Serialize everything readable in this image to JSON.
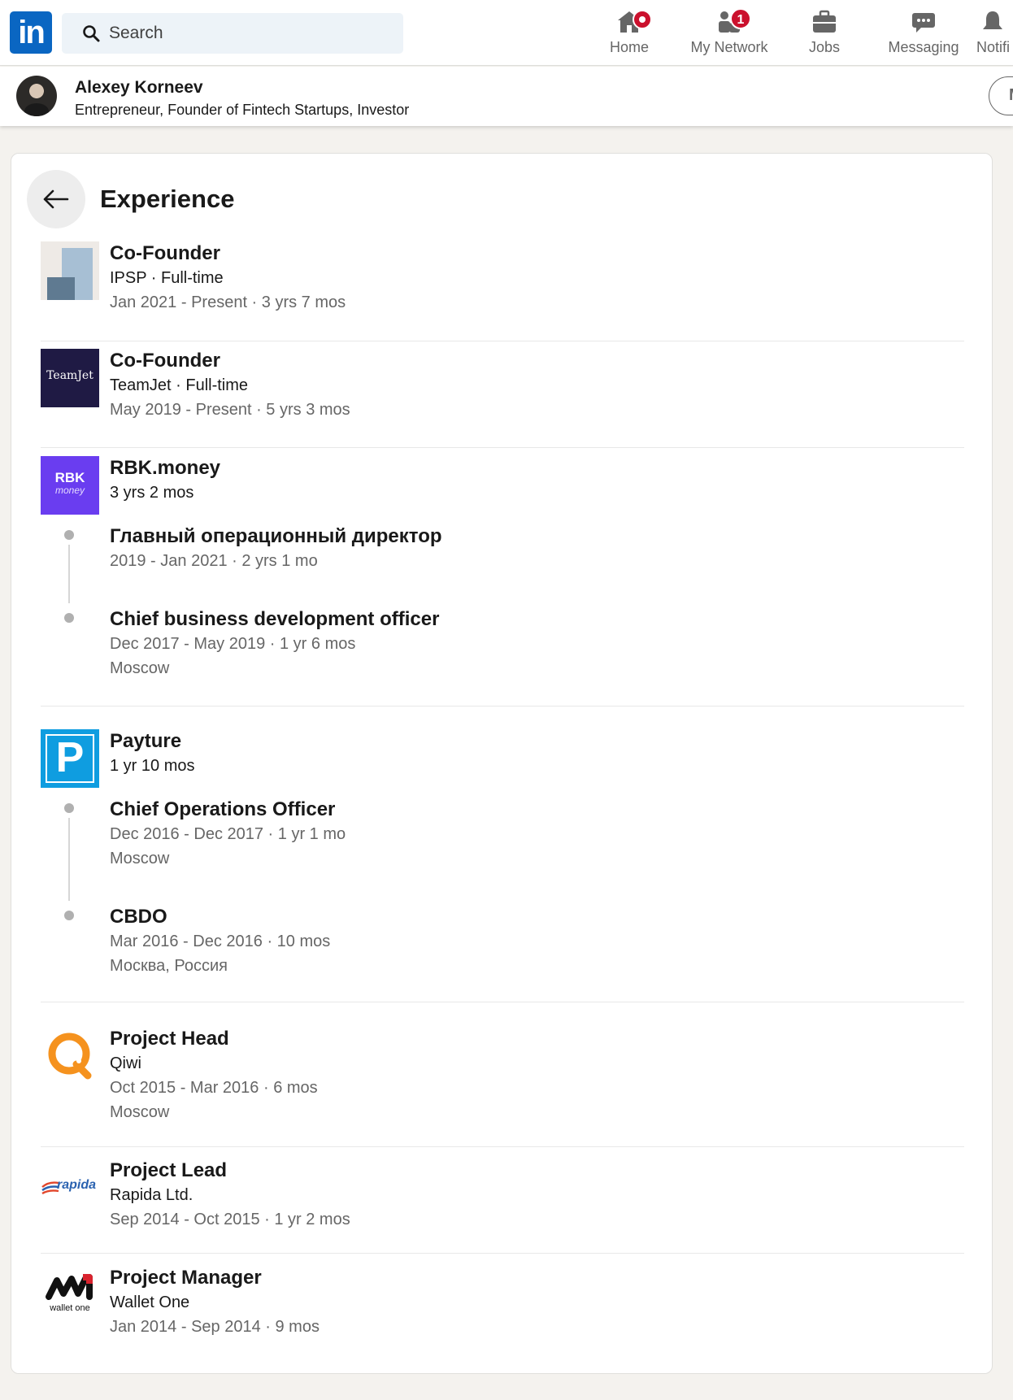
{
  "nav": {
    "search_placeholder": "Search",
    "items": [
      {
        "label": "Home",
        "badge": ""
      },
      {
        "label": "My Network",
        "badge": "1"
      },
      {
        "label": "Jobs",
        "badge": ""
      },
      {
        "label": "Messaging",
        "badge": ""
      },
      {
        "label": "Notifi",
        "badge": ""
      }
    ]
  },
  "profile_bar": {
    "name": "Alexey Korneev",
    "headline": "Entrepreneur, Founder of Fintech Startups, Investor",
    "button_label": "M"
  },
  "section": {
    "title": "Experience"
  },
  "experience": [
    {
      "title": "Co-Founder",
      "subtitle": "IPSP · Full-time",
      "dates": "Jan 2021 - Present · 3 yrs 7 mos",
      "logo": "ipsp-logo"
    },
    {
      "title": "Co-Founder",
      "subtitle": "TeamJet · Full-time",
      "dates": "May 2019 - Present · 5 yrs 3 mos",
      "logo": "teamjet-logo",
      "logo_text": "TeamJet"
    },
    {
      "company": "RBK.money",
      "duration": "3 yrs 2 mos",
      "logo": "rbk-logo",
      "logo_text_1": "RBK",
      "logo_text_2": "money",
      "roles": [
        {
          "title": "Главный операционный директор",
          "dates": "2019 - Jan 2021 · 2 yrs 1 mo"
        },
        {
          "title": "Chief business development officer",
          "dates": "Dec 2017 - May 2019 · 1 yr 6 mos",
          "location": "Moscow"
        }
      ]
    },
    {
      "company": "Payture",
      "duration": "1 yr 10 mos",
      "logo": "payture-logo",
      "logo_text": "P",
      "roles": [
        {
          "title": "Chief Operations Officer",
          "dates": "Dec 2016 - Dec 2017 · 1 yr 1 mo",
          "location": "Moscow"
        },
        {
          "title": "CBDO",
          "dates": "Mar 2016 - Dec 2016 · 10 mos",
          "location": "Москва, Россия"
        }
      ]
    },
    {
      "title": "Project Head",
      "subtitle": "Qiwi",
      "dates": "Oct 2015 - Mar 2016 · 6 mos",
      "location": "Moscow",
      "logo": "qiwi-logo"
    },
    {
      "title": "Project Lead",
      "subtitle": "Rapida Ltd.",
      "dates": "Sep 2014 - Oct 2015 · 1 yr 2 mos",
      "logo": "rapida-logo",
      "logo_text": "rapida"
    },
    {
      "title": "Project Manager",
      "subtitle": "Wallet One",
      "dates": "Jan 2014 - Sep 2014 · 9 mos",
      "logo": "walletone-logo",
      "logo_text": "wallet one"
    }
  ],
  "colors": {
    "brand": "#0a66c2",
    "badge": "#cb112d",
    "teamjet": "#1f1a44",
    "rbk": "#6a3df0",
    "payture": "#0f9de0",
    "qiwi": "#f5921e"
  }
}
